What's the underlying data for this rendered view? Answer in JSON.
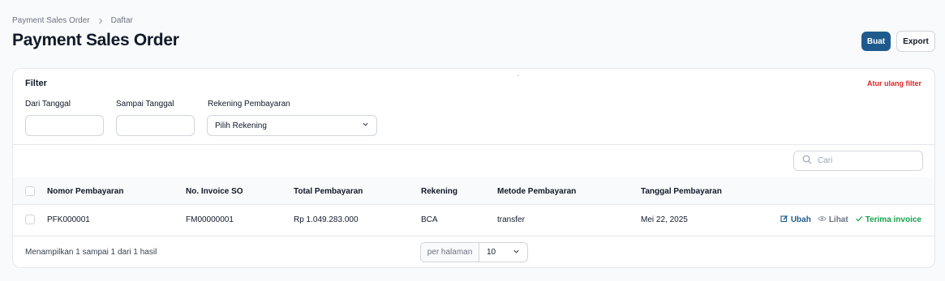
{
  "breadcrumb": {
    "parent": "Payment Sales Order",
    "current": "Daftar"
  },
  "page": {
    "title": "Payment Sales Order"
  },
  "header_actions": {
    "create_label": "Buat",
    "export_label": "Export"
  },
  "filter": {
    "title": "Filter",
    "reset_label": "Atur ulang filter",
    "from_date_label": "Dari Tanggal",
    "to_date_label": "Sampai Tanggal",
    "account_label": "Rekening Pembayaran",
    "account_value": "Pilih Rekening"
  },
  "search": {
    "placeholder": "Cari"
  },
  "table": {
    "columns": [
      "Nomor Pembayaran",
      "No. Invoice SO",
      "Total Pembayaran",
      "Rekening",
      "Metode Pembayaran",
      "Tanggal Pembayaran"
    ],
    "rows": [
      {
        "number": "PFK000001",
        "invoice": "FM00000001",
        "total": "Rp 1.049.283.000",
        "account": "BCA",
        "method": "transfer",
        "date": "Mei 22, 2025"
      }
    ],
    "row_actions": {
      "edit": "Ubah",
      "view": "Lihat",
      "accept": "Terima invoice"
    }
  },
  "footer": {
    "summary": "Menampilkan 1 sampai 1 dari 1 hasil",
    "per_page_label": "per halaman",
    "per_page_value": "10"
  },
  "colors": {
    "primary": "#1e5b8c",
    "danger": "#dc2626",
    "success": "#16a34a",
    "muted": "#6b7280"
  }
}
